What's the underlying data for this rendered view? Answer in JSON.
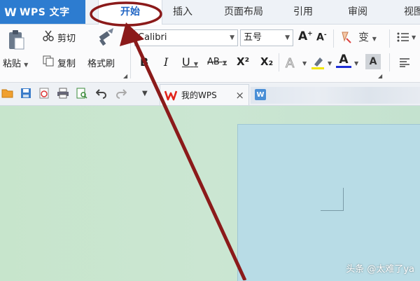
{
  "app": {
    "logo": "W",
    "title": "WPS 文字"
  },
  "tabs": [
    "开始",
    "插入",
    "页面布局",
    "引用",
    "审阅",
    "视图"
  ],
  "active_tab": "开始",
  "ribbon": {
    "paste_label": "粘贴",
    "cut_label": "剪切",
    "copy_label": "复制",
    "format_painter_label": "格式刷",
    "font_name": "Calibri",
    "font_size": "五号",
    "bold": "B",
    "italic": "I",
    "underline": "U",
    "strikethrough": "AB",
    "superscript": "X²",
    "subscript": "X₂",
    "grow_font": "A",
    "shrink_font": "A",
    "phonetic": "变",
    "font_color_letter": "A"
  },
  "quick_bar": {
    "doc_tab_title": "我的WPS",
    "close": "×"
  },
  "watermark": "头条 @太难了ya",
  "colors": {
    "app_blue": "#2d7cd0",
    "annotation": "#8b1a1a",
    "wps_red": "#e2231a",
    "page": "#b8dce6",
    "workspace": "#c9e3cf"
  }
}
